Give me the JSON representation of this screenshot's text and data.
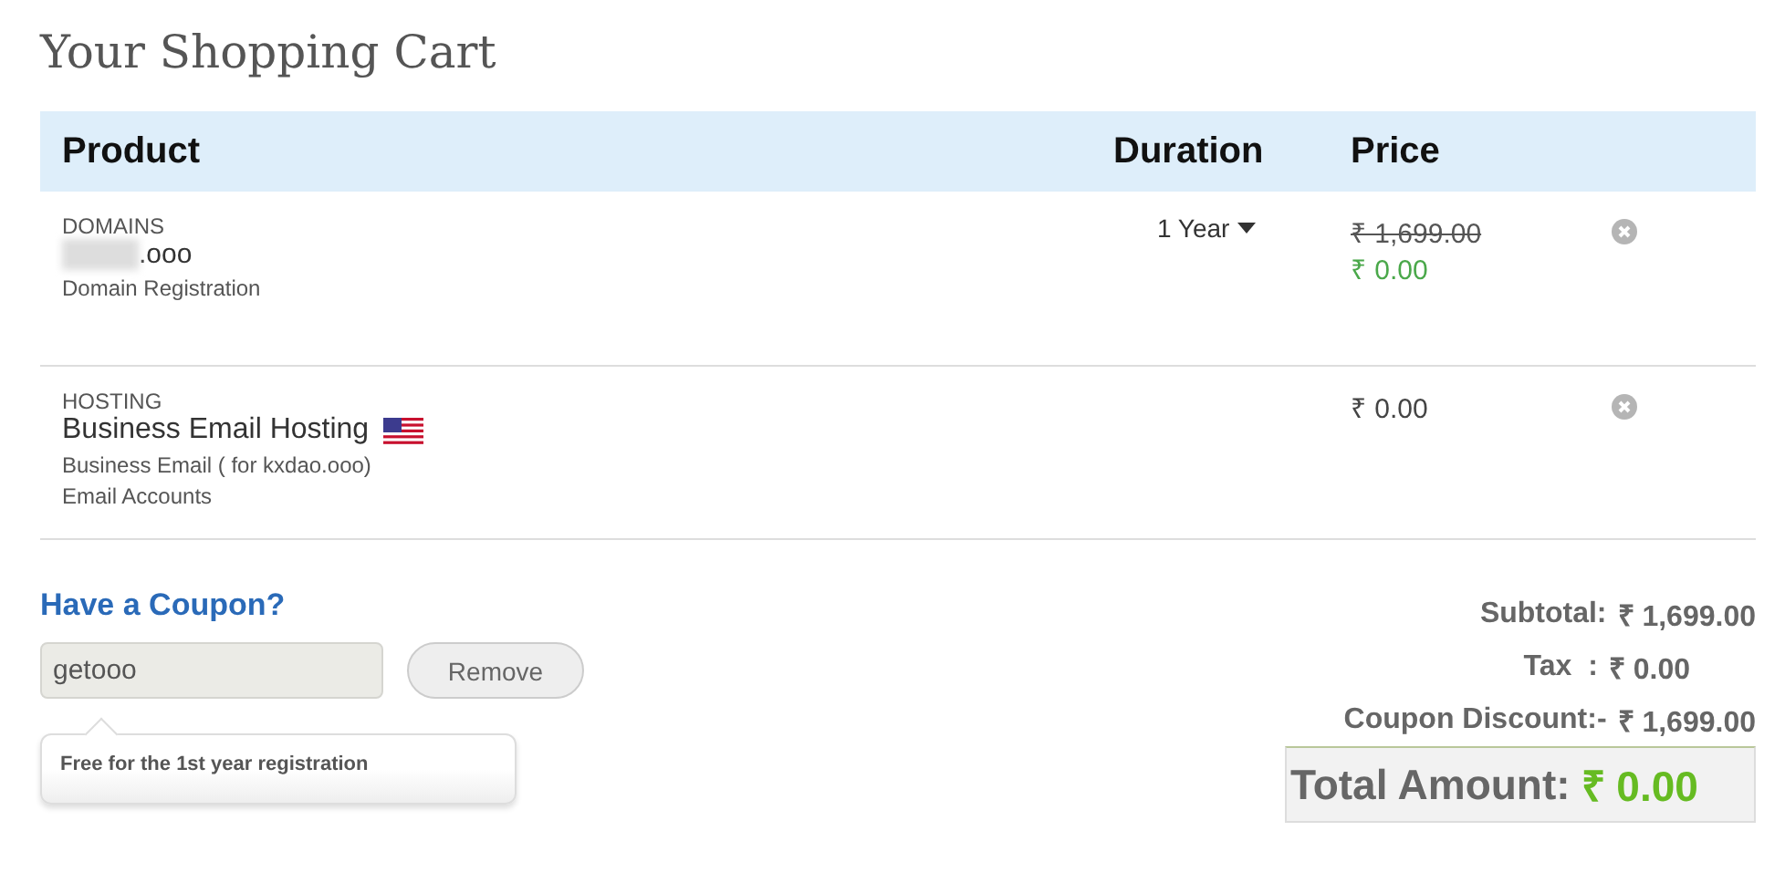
{
  "title": "Your Shopping Cart",
  "table": {
    "columns": [
      "Product",
      "Duration",
      "Price"
    ],
    "rows": [
      {
        "category": "DOMAINS",
        "name": ".ooo",
        "name_redacted": true,
        "flag": false,
        "details": [
          "Domain Registration"
        ],
        "duration": "1 Year",
        "old_price": "₹ 1,699.00",
        "price": "₹ 0.00",
        "price_discounted": true
      },
      {
        "category": "HOSTING",
        "name": "Business Email Hosting",
        "name_redacted": false,
        "flag": true,
        "details": [
          "Business Email ( for kxdao.ooo)",
          "Email Accounts"
        ],
        "price": "₹ 0.00",
        "price_discounted": false
      }
    ]
  },
  "coupon": {
    "heading": "Have a Coupon?",
    "value": "getooo",
    "button": "Remove",
    "note": "Free for the 1st year registration"
  },
  "summary": [
    {
      "label": "Subtotal:",
      "value": "₹ 1,699.00"
    },
    {
      "label": "Tax  :",
      "value": "₹ 0.00"
    },
    {
      "label": "Coupon Discount:-",
      "value": "₹ 1,699.00"
    }
  ],
  "total": {
    "label": "Total Amount:",
    "value": "₹ 0.00"
  }
}
